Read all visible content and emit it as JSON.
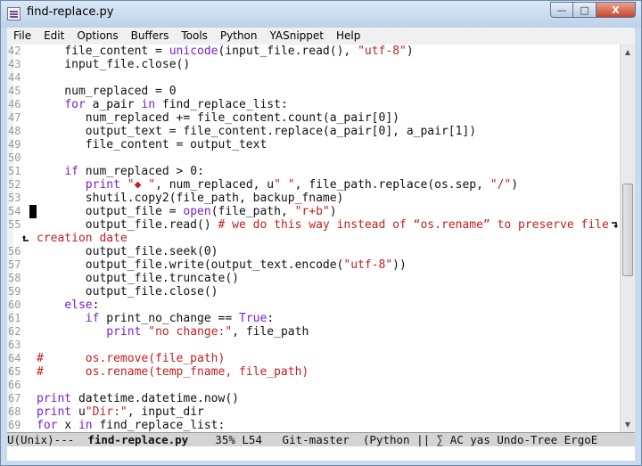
{
  "window": {
    "title": "find-replace.py",
    "minimize_glyph": "—",
    "maximize_glyph": "□",
    "close_glyph": "X"
  },
  "menu": [
    "File",
    "Edit",
    "Options",
    "Buffers",
    "Tools",
    "Python",
    "YASnippet",
    "Help"
  ],
  "editor": {
    "cursor_line": 54,
    "lines": [
      {
        "n": "42",
        "segs": [
          [
            "n",
            "    file_content = "
          ],
          [
            "b",
            "unicode"
          ],
          [
            "n",
            "(input_file.read(), "
          ],
          [
            "s",
            "\"utf-8\""
          ],
          [
            "n",
            ")"
          ]
        ]
      },
      {
        "n": "43",
        "segs": [
          [
            "n",
            "    input_file.close()"
          ]
        ]
      },
      {
        "n": "44",
        "segs": []
      },
      {
        "n": "45",
        "segs": [
          [
            "n",
            "    num_replaced = 0"
          ]
        ]
      },
      {
        "n": "46",
        "segs": [
          [
            "n",
            "    "
          ],
          [
            "k",
            "for"
          ],
          [
            "n",
            " a_pair "
          ],
          [
            "k",
            "in"
          ],
          [
            "n",
            " find_replace_list:"
          ]
        ]
      },
      {
        "n": "47",
        "segs": [
          [
            "n",
            "       num_replaced += file_content.count(a_pair[0])"
          ]
        ]
      },
      {
        "n": "48",
        "segs": [
          [
            "n",
            "       output_text = file_content.replace(a_pair[0], a_pair[1])"
          ]
        ]
      },
      {
        "n": "49",
        "segs": [
          [
            "n",
            "       file_content = output_text"
          ]
        ]
      },
      {
        "n": "50",
        "segs": []
      },
      {
        "n": "51",
        "segs": [
          [
            "n",
            "    "
          ],
          [
            "k",
            "if"
          ],
          [
            "n",
            " num_replaced > 0:"
          ]
        ]
      },
      {
        "n": "52",
        "segs": [
          [
            "n",
            "       "
          ],
          [
            "k",
            "print"
          ],
          [
            "n",
            " "
          ],
          [
            "s",
            "\"◆ \""
          ],
          [
            "n",
            ", num_replaced, u"
          ],
          [
            "s",
            "\" \""
          ],
          [
            "n",
            ", file_path.replace(os.sep, "
          ],
          [
            "s",
            "\"/\""
          ],
          [
            "n",
            ")"
          ]
        ]
      },
      {
        "n": "53",
        "segs": [
          [
            "n",
            "       shutil.copy2(file_path, backup_fname)"
          ]
        ]
      },
      {
        "n": "54",
        "segs": [
          [
            "n",
            "       output_file = "
          ],
          [
            "b",
            "open"
          ],
          [
            "n",
            "(file_path, "
          ],
          [
            "s",
            "\"r+b\""
          ],
          [
            "n",
            ")"
          ]
        ]
      },
      {
        "n": "55",
        "segs": [
          [
            "n",
            "       output_file.read() "
          ],
          [
            "c",
            "# we do this way instead of “os.rename” to preserve file"
          ]
        ]
      },
      {
        "n": "",
        "segs": [
          [
            "c",
            "creation date"
          ]
        ]
      },
      {
        "n": "56",
        "segs": [
          [
            "n",
            "       output_file.seek(0)"
          ]
        ]
      },
      {
        "n": "57",
        "segs": [
          [
            "n",
            "       output_file.write(output_text.encode("
          ],
          [
            "s",
            "\"utf-8\""
          ],
          [
            "n",
            "))"
          ]
        ]
      },
      {
        "n": "58",
        "segs": [
          [
            "n",
            "       output_file.truncate()"
          ]
        ]
      },
      {
        "n": "59",
        "segs": [
          [
            "n",
            "       output_file.close()"
          ]
        ]
      },
      {
        "n": "60",
        "segs": [
          [
            "n",
            "    "
          ],
          [
            "k",
            "else"
          ],
          [
            "n",
            ":"
          ]
        ]
      },
      {
        "n": "61",
        "segs": [
          [
            "n",
            "       "
          ],
          [
            "k",
            "if"
          ],
          [
            "n",
            " print_no_change == "
          ],
          [
            "b",
            "True"
          ],
          [
            "n",
            ":"
          ]
        ]
      },
      {
        "n": "62",
        "segs": [
          [
            "n",
            "          "
          ],
          [
            "k",
            "print"
          ],
          [
            "n",
            " "
          ],
          [
            "s",
            "\"no change:\""
          ],
          [
            "n",
            ", file_path"
          ]
        ]
      },
      {
        "n": "63",
        "segs": []
      },
      {
        "n": "64",
        "segs": [
          [
            "c",
            "#      os.remove(file_path)"
          ]
        ]
      },
      {
        "n": "65",
        "segs": [
          [
            "c",
            "#      os.rename(temp_fname, file_path)"
          ]
        ]
      },
      {
        "n": "66",
        "segs": []
      },
      {
        "n": "67",
        "segs": [
          [
            "k",
            "print"
          ],
          [
            "n",
            " datetime.datetime.now()"
          ]
        ]
      },
      {
        "n": "68",
        "segs": [
          [
            "k",
            "print"
          ],
          [
            "n",
            " u"
          ],
          [
            "s",
            "\"Dir:\""
          ],
          [
            "n",
            ", input_dir"
          ]
        ]
      },
      {
        "n": "69",
        "segs": [
          [
            "k",
            "for"
          ],
          [
            "n",
            " x "
          ],
          [
            "k",
            "in"
          ],
          [
            "n",
            " find_replace_list:"
          ]
        ]
      }
    ]
  },
  "modeline": {
    "prefix": "U(Unix)---  ",
    "buffer_name": "find-replace.py",
    "suffix": "    35% L54   Git-master  (Python || ∑ AC yas Undo-Tree ErgoE"
  }
}
